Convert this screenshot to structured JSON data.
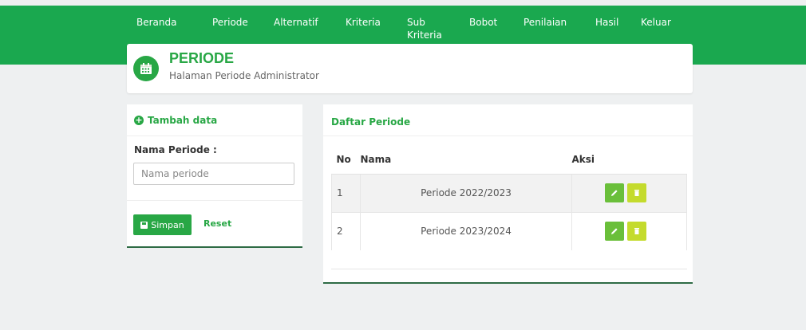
{
  "nav": {
    "items": [
      "Beranda",
      "Periode",
      "Alternatif",
      "Kriteria",
      "Sub Kriteria",
      "Bobot",
      "Penilaian",
      "Hasil",
      "Keluar"
    ]
  },
  "header": {
    "title": "PERIODE",
    "subtitle": "Halaman Periode Administrator",
    "icon": "calendar-icon"
  },
  "form": {
    "title": "Tambah data",
    "label": "Nama Periode :",
    "placeholder": "Nama periode",
    "value": "",
    "save_label": "Simpan",
    "reset_label": "Reset"
  },
  "list": {
    "title": "Daftar Periode",
    "columns": [
      "No",
      "Nama",
      "Aksi"
    ],
    "rows": [
      {
        "no": "1",
        "nama": "Periode 2022/2023"
      },
      {
        "no": "2",
        "nama": "Periode 2023/2024"
      }
    ]
  },
  "colors": {
    "brand": "#1aa84f",
    "accent": "#28a745",
    "edit": "#6abf3a",
    "delete": "#c4db2d"
  }
}
